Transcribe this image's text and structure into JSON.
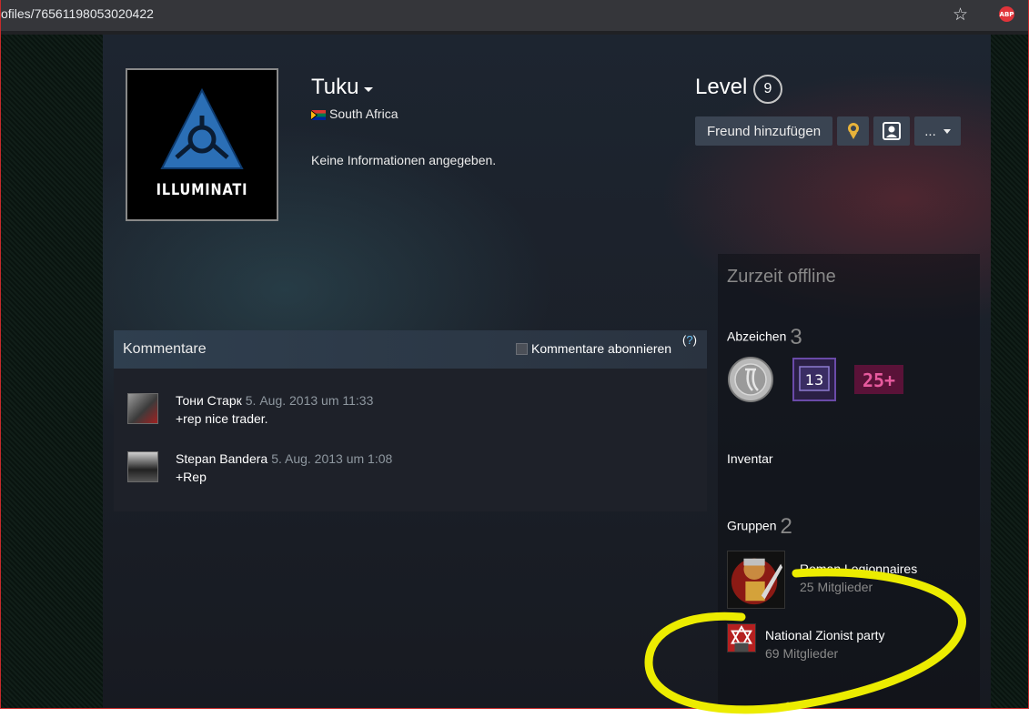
{
  "browser": {
    "url_fragment": "ofiles/76561198053020422",
    "extension_badge": "ABP"
  },
  "profile": {
    "name": "Tuku",
    "country": "South Africa",
    "summary": "Keine Informationen angegeben.",
    "avatar_logo_text": "ILLUMINATI",
    "level_label": "Level",
    "level_value": "9"
  },
  "actions": {
    "add_friend": "Freund hinzufügen",
    "more": "..."
  },
  "comments": {
    "title": "Kommentare",
    "subscribe_label": "Kommentare abonnieren",
    "help_open": "(",
    "help_q": "?",
    "help_close": ")",
    "items": [
      {
        "author": "Тони Старк",
        "date": "5. Aug. 2013 um 11:33",
        "text": "+rep nice trader."
      },
      {
        "author": "Stepan Bandera",
        "date": "5. Aug. 2013 um 1:08",
        "text": "+Rep"
      }
    ]
  },
  "sidebar": {
    "status": "Zurzeit offline",
    "badges_label": "Abzeichen",
    "badges_count": "3",
    "badges": [
      {
        "icon": "silver-coin-badge-icon"
      },
      {
        "icon": "purple-badge-icon",
        "text": "13"
      },
      {
        "icon": "years-badge-icon",
        "text": "25+"
      }
    ],
    "inventory_label": "Inventar",
    "groups_label": "Gruppen",
    "groups_count": "2",
    "groups": [
      {
        "name": "Roman Legionnaires",
        "members": "25 Mitglieder"
      },
      {
        "name": "National Zionist party",
        "members": "69 Mitglieder"
      }
    ],
    "cutoff_text": "13"
  },
  "colors": {
    "accent_blue": "#66c0f4",
    "button_bg": "#3a4452",
    "annotation_yellow": "#ecec00"
  }
}
